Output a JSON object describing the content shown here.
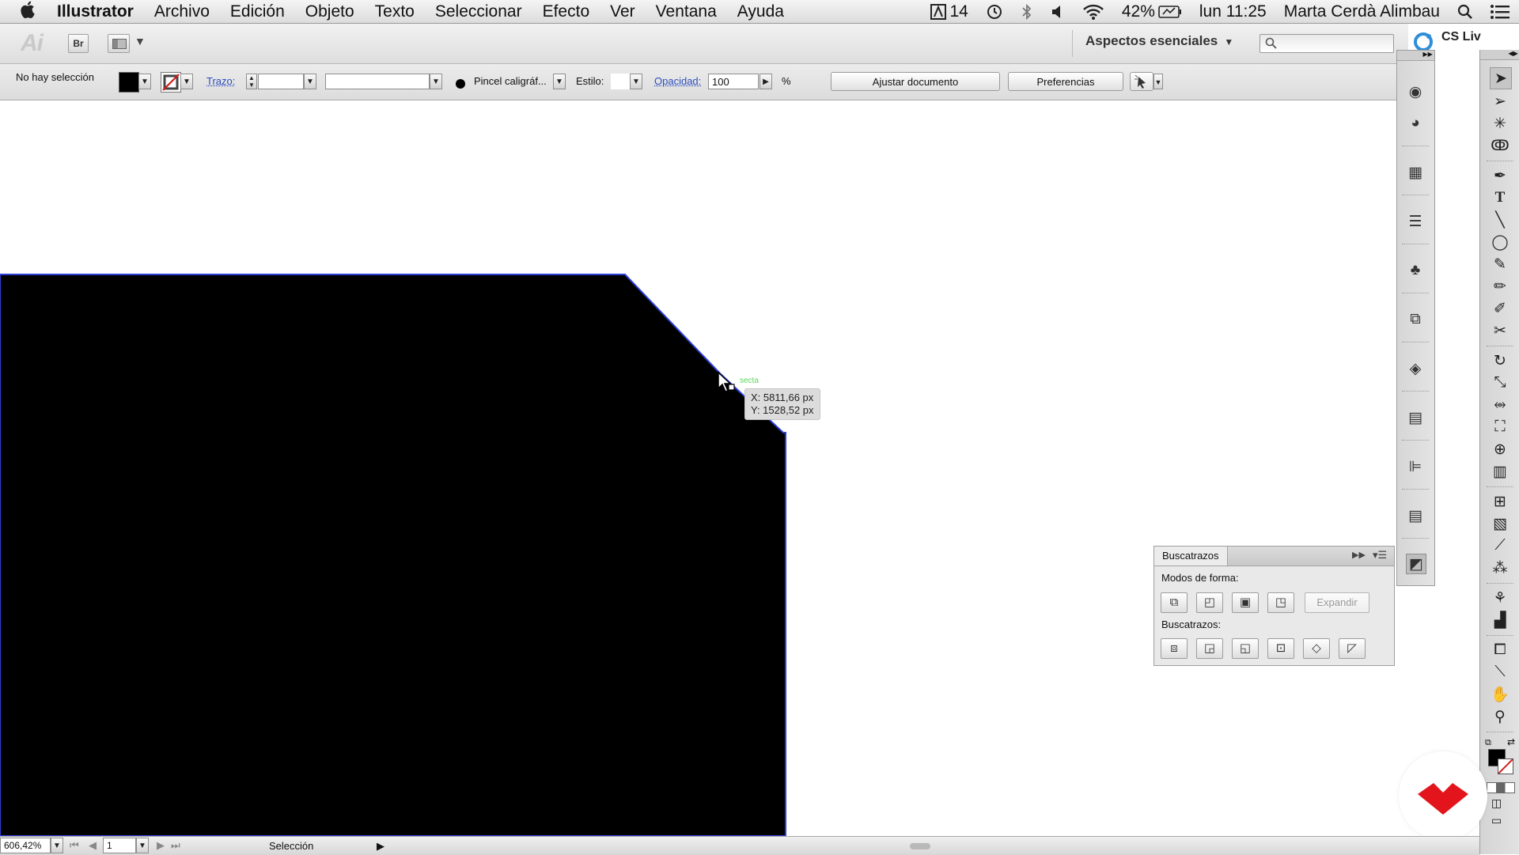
{
  "menubar": {
    "app_name": "Illustrator",
    "items": [
      "Archivo",
      "Edición",
      "Objeto",
      "Texto",
      "Seleccionar",
      "Efecto",
      "Ver",
      "Ventana",
      "Ayuda"
    ],
    "status": {
      "adobe_count": "14",
      "battery": "42%",
      "clock": "lun 11:25",
      "user": "Marta Cerdà Alimbau"
    }
  },
  "appbar": {
    "logo_text": "Ai",
    "bridge_label": "Br",
    "workspace_label": "Aspectos esenciales",
    "search_placeholder": "",
    "cs_live_label": "CS Liv"
  },
  "controlbar": {
    "selection_status": "No hay selección",
    "stroke_label": "Trazo:",
    "stroke_value": "",
    "brush_label": "Pincel caligráf...",
    "style_label": "Estilo:",
    "opacity_label": "Opacidad:",
    "opacity_value": "100",
    "opacity_unit": "%",
    "adjust_document_button": "Ajustar documento",
    "preferences_button": "Preferencias"
  },
  "canvas": {
    "tooltip_x": "X: 5811,66 px",
    "tooltip_y": "Y: 1528,52 px",
    "smart_guide_hint": "secta",
    "shape_fill": "#000000",
    "shape_outline": "#2d3fd6"
  },
  "pathfinder": {
    "tab_title": "Buscatrazos",
    "shape_modes_label": "Modos de forma:",
    "expand_button": "Expandir",
    "pathfinders_label": "Buscatrazos:"
  },
  "statusbar": {
    "zoom": "606,42%",
    "artboard_number": "1",
    "current_tool": "Selección"
  },
  "colors": {
    "link_blue": "#2b4cc0",
    "brand_red": "#e3141b"
  }
}
